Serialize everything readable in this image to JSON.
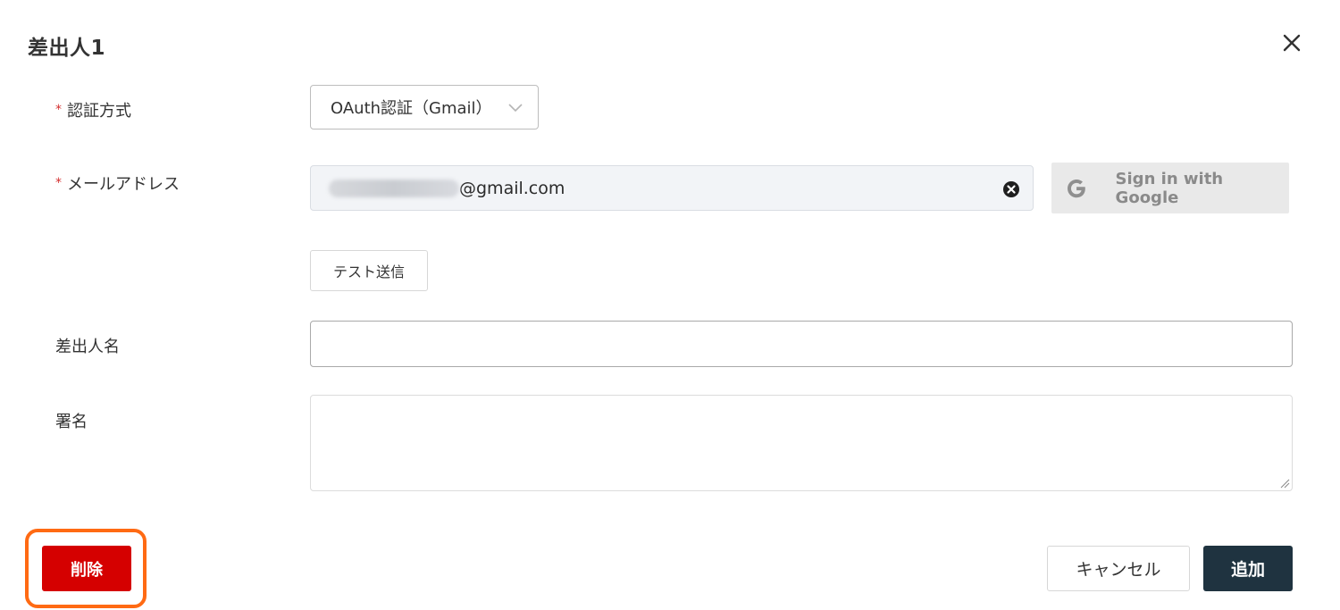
{
  "dialog": {
    "title": "差出人1"
  },
  "form": {
    "auth_method": {
      "label": "認証方式",
      "required_mark": "*",
      "selected": "OAuth認証（Gmail）"
    },
    "email": {
      "label": "メールアドレス",
      "required_mark": "*",
      "value_suffix": "@gmail.com"
    },
    "google_signin": {
      "label": "Sign in with Google"
    },
    "test_send": {
      "label": "テスト送信"
    },
    "sender_name": {
      "label": "差出人名",
      "value": ""
    },
    "signature": {
      "label": "署名",
      "value": ""
    }
  },
  "footer": {
    "delete_label": "削除",
    "cancel_label": "キャンセル",
    "add_label": "追加"
  },
  "colors": {
    "delete": "#d50000",
    "add": "#1f3340",
    "highlight": "#ff6a13",
    "required": "#d32f2f"
  }
}
